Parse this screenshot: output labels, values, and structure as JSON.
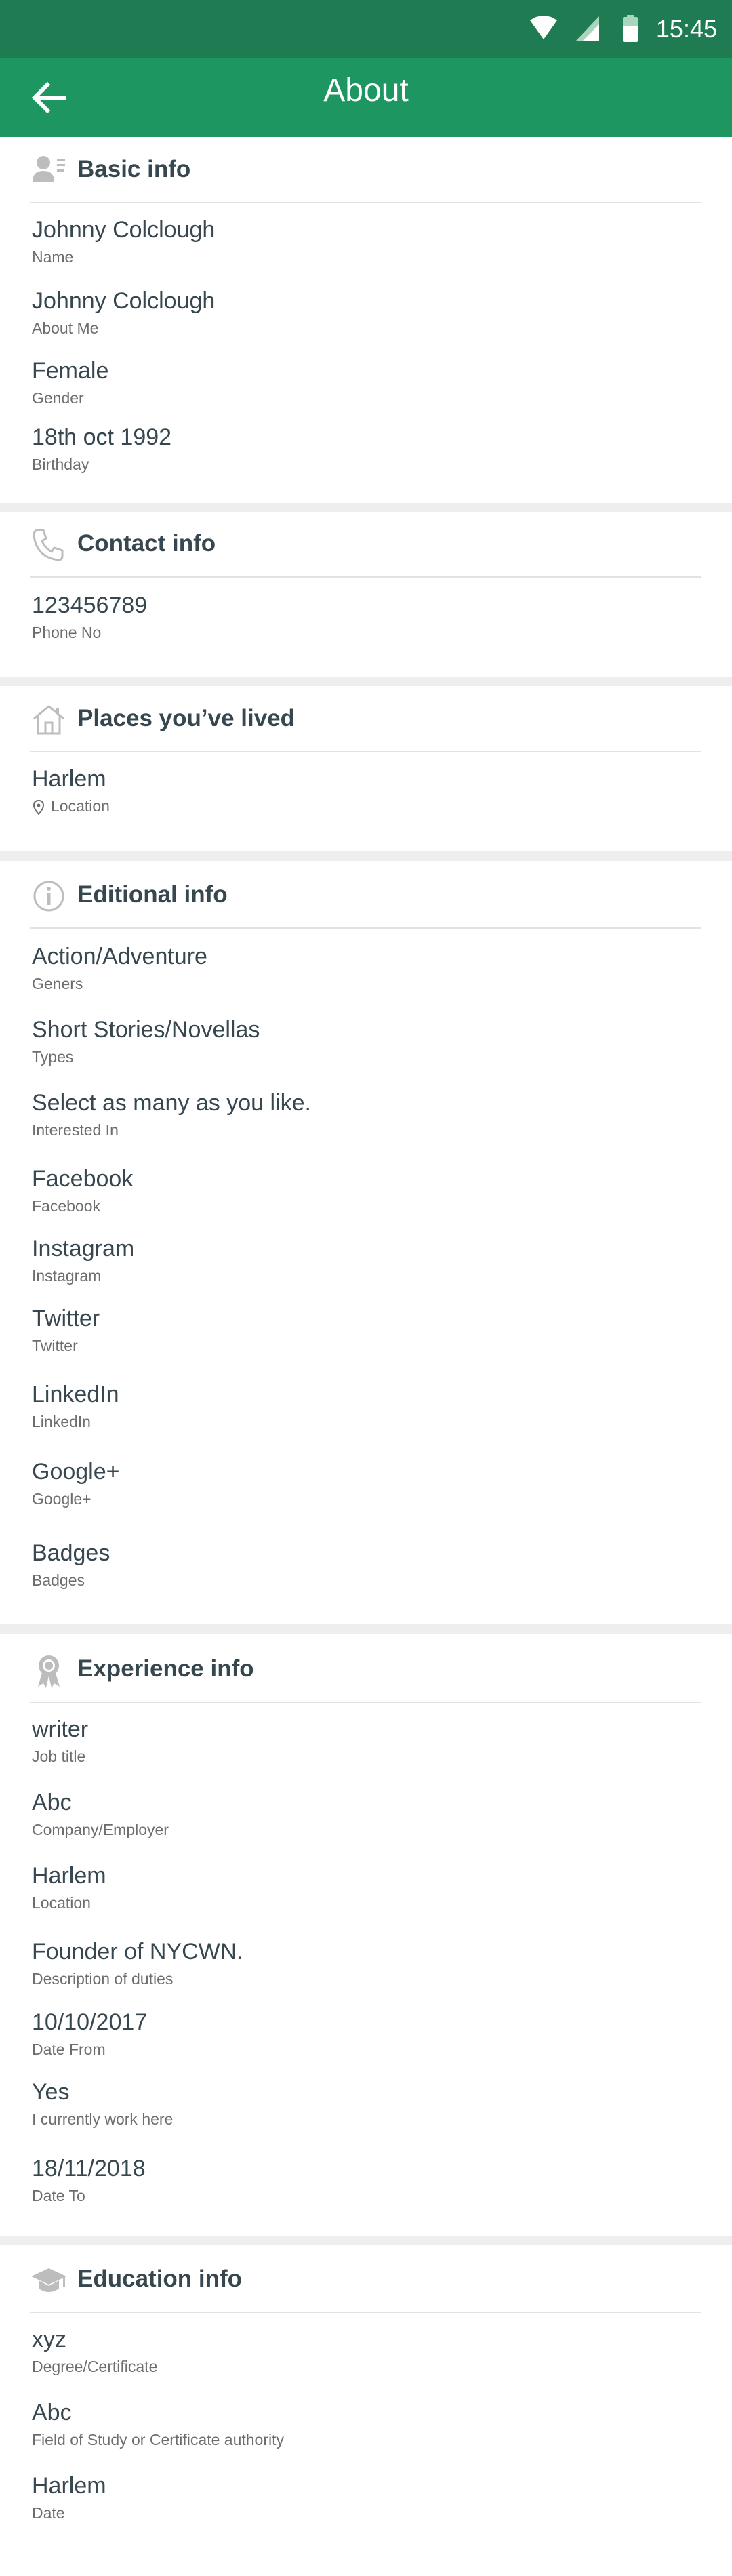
{
  "status_bar": {
    "time": "15:45"
  },
  "app_bar": {
    "title": "About"
  },
  "sections": {
    "basic": {
      "title": "Basic info",
      "items": [
        {
          "value": "Johnny Colclough",
          "label": "Name"
        },
        {
          "value": "Johnny Colclough",
          "label": "About Me"
        },
        {
          "value": "Female",
          "label": "Gender"
        },
        {
          "value": "18th oct 1992",
          "label": "Birthday"
        }
      ]
    },
    "contact": {
      "title": "Contact info",
      "items": [
        {
          "value": "123456789",
          "label": "Phone No"
        }
      ]
    },
    "places": {
      "title": "Places you’ve lived",
      "items": [
        {
          "value": "Harlem",
          "label": "Location"
        }
      ]
    },
    "editional": {
      "title": "Editional info",
      "items": [
        {
          "value": "Action/Adventure",
          "label": "Geners"
        },
        {
          "value": "Short Stories/Novellas",
          "label": "Types"
        },
        {
          "value": "Select as many as you like.",
          "label": "Interested In"
        },
        {
          "value": "Facebook",
          "label": "Facebook"
        },
        {
          "value": "Instagram",
          "label": "Instagram"
        },
        {
          "value": "Twitter",
          "label": "Twitter"
        },
        {
          "value": "LinkedIn",
          "label": "LinkedIn"
        },
        {
          "value": "Google+",
          "label": "Google+"
        },
        {
          "value": "Badges",
          "label": "Badges"
        }
      ]
    },
    "experience": {
      "title": "Experience info",
      "items": [
        {
          "value": "writer",
          "label": "Job title"
        },
        {
          "value": "Abc",
          "label": "Company/Employer"
        },
        {
          "value": "Harlem",
          "label": "Location"
        },
        {
          "value": "Founder of NYCWN.",
          "label": "Description of duties"
        },
        {
          "value": "10/10/2017",
          "label": "Date From"
        },
        {
          "value": "Yes",
          "label": "I currently work here"
        },
        {
          "value": "18/11/2018",
          "label": "Date To"
        }
      ]
    },
    "education": {
      "title": "Education info",
      "items": [
        {
          "value": "xyz",
          "label": "Degree/Certificate"
        },
        {
          "value": "Abc",
          "label": "Field of Study or Certificate authority"
        },
        {
          "value": "Harlem",
          "label": "Date"
        }
      ]
    }
  },
  "colors": {
    "status_bar": "#1f7c52",
    "app_bar": "#1e9662",
    "text_primary": "#37474f",
    "text_secondary": "#6d6d6d",
    "divider": "#e2e2e2",
    "section_gap": "#eeeeee"
  },
  "icons": {
    "status": [
      "wifi-icon",
      "signal-icon",
      "battery-icon"
    ],
    "back": "arrow-left-icon",
    "basic": "person-card-icon",
    "contact": "phone-icon",
    "places": "home-icon",
    "location": "map-pin-icon",
    "editional": "info-icon",
    "experience": "ribbon-award-icon",
    "education": "graduation-cap-icon"
  }
}
